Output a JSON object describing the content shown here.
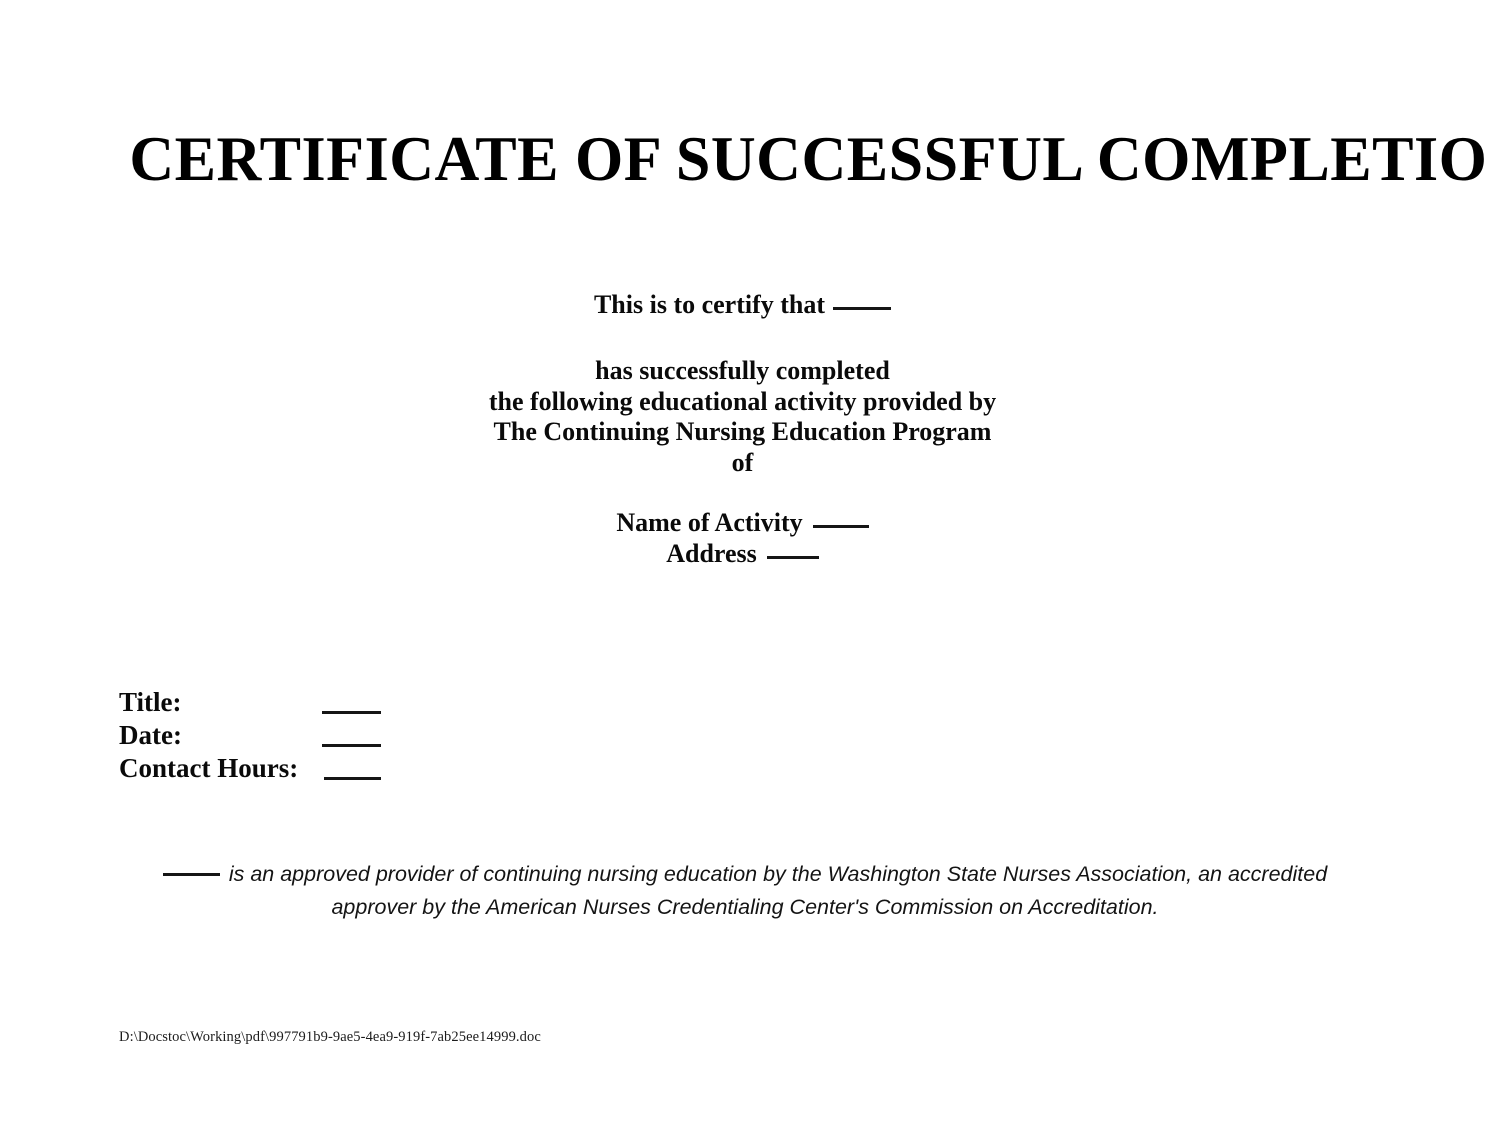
{
  "document": {
    "title": "CERTIFICATE OF SUCCESSFUL COMPLETION"
  },
  "certify": {
    "line_1_text": "This is to certify that",
    "line_1_blank": "____"
  },
  "body": {
    "line_1": "has successfully completed",
    "line_2": "the following educational activity provided by",
    "line_3": "The Continuing Nursing Education Program",
    "line_4": "of"
  },
  "activity": {
    "name_label": "Name of Activity",
    "name_blank": "____",
    "address_label": "Address",
    "address_blank": "____"
  },
  "fields": [
    {
      "label": "Title:",
      "value_blank": "____"
    },
    {
      "label": "Date:",
      "value_blank": "____"
    },
    {
      "label": "Contact Hours:",
      "value_blank": "____"
    }
  ],
  "accreditation": {
    "lead_blank": "____",
    "line_1": "is an approved provider of continuing nursing education by the Washington State Nurses Association, an accredited",
    "line_2": "approver by the American Nurses Credentialing Center's Commission on Accreditation."
  },
  "footer": {
    "file_path": "D:\\Docstoc\\Working\\pdf\\997791b9-9ae5-4ea9-919f-7ab25ee14999.doc"
  },
  "colors": {
    "page_background": "#ffffff",
    "text": "#000000",
    "rule": "#151515"
  }
}
